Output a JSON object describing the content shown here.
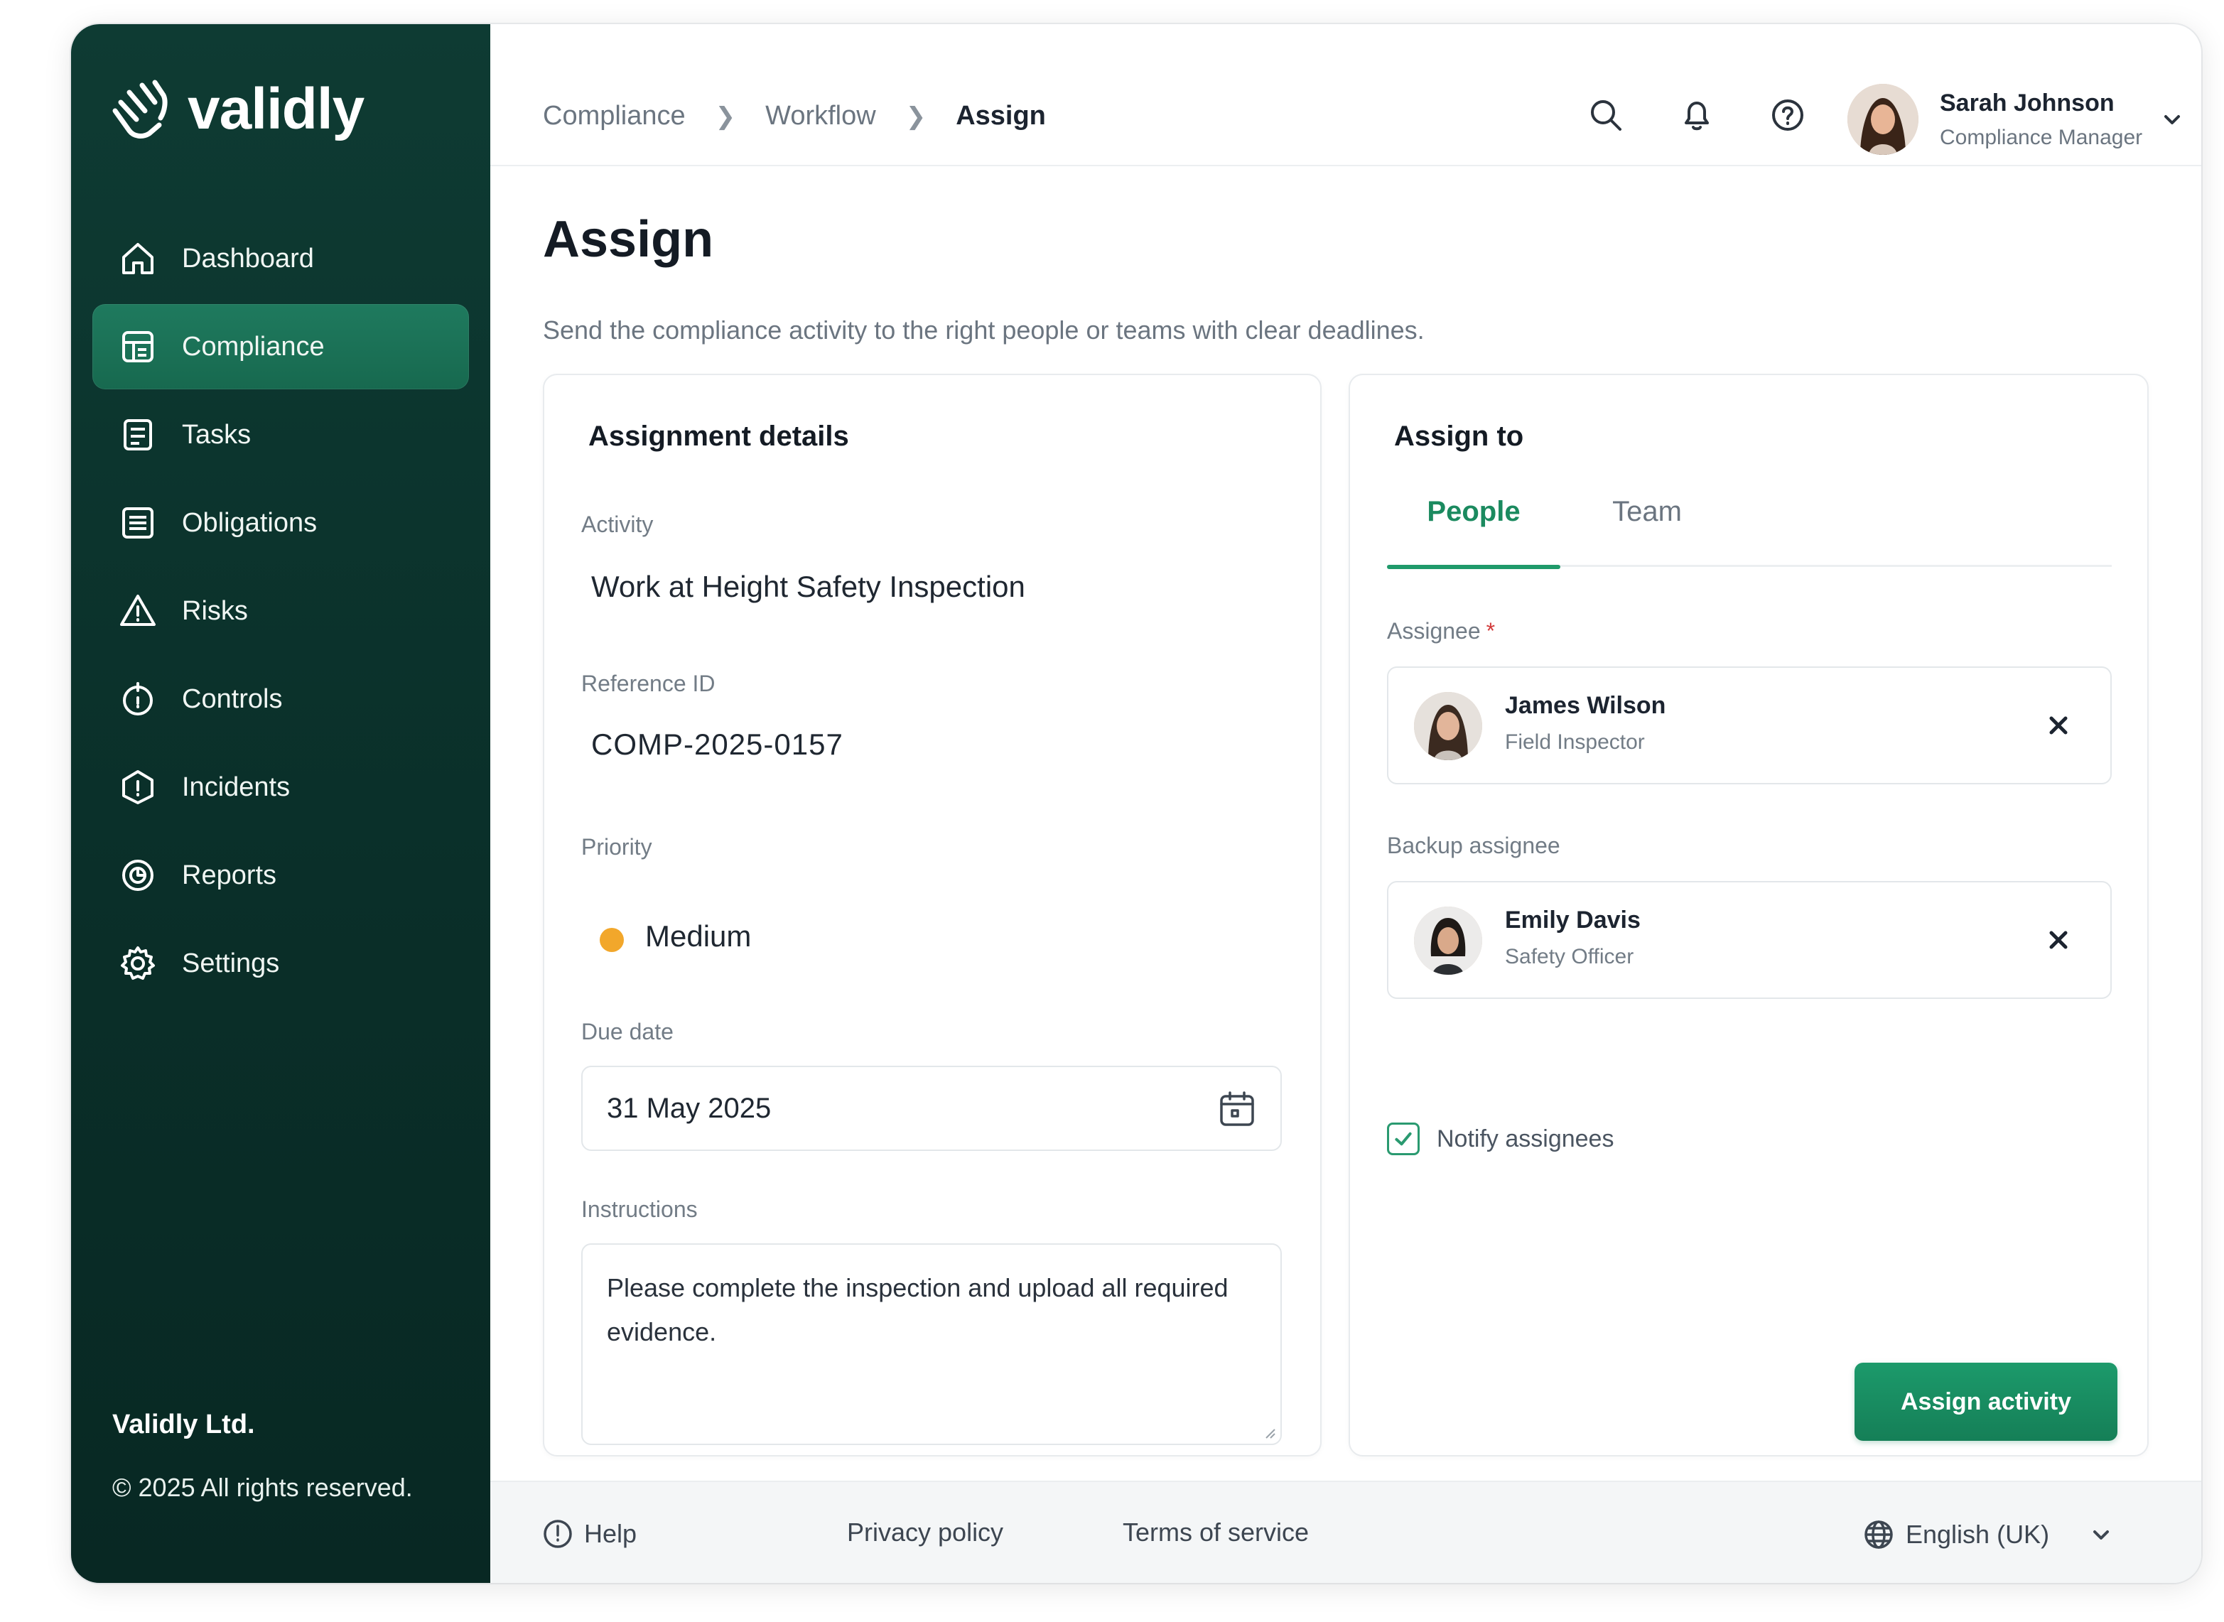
{
  "brand": {
    "name": "validly"
  },
  "sidebar": {
    "items": [
      {
        "label": "Dashboard",
        "icon": "home-icon"
      },
      {
        "label": "Compliance",
        "icon": "compliance-icon",
        "active": true
      },
      {
        "label": "Tasks",
        "icon": "tasks-icon"
      },
      {
        "label": "Obligations",
        "icon": "obligations-icon"
      },
      {
        "label": "Risks",
        "icon": "warning-triangle-icon"
      },
      {
        "label": "Controls",
        "icon": "shield-icon"
      },
      {
        "label": "Incidents",
        "icon": "incident-icon"
      },
      {
        "label": "Reports",
        "icon": "reports-icon"
      },
      {
        "label": "Settings",
        "icon": "gear-icon"
      }
    ],
    "footer": {
      "company": "Validly Ltd.",
      "rights": "© 2025 All rights reserved."
    }
  },
  "breadcrumb": {
    "items": [
      "Compliance",
      "Workflow",
      "Assign"
    ]
  },
  "user": {
    "name": "Sarah Johnson",
    "role": "Compliance Manager"
  },
  "page": {
    "title": "Assign",
    "subtitle": "Send the compliance activity to the right people or teams with clear deadlines."
  },
  "details": {
    "title": "Assignment details",
    "activity_label": "Activity",
    "activity_value": "Work at Height Safety Inspection",
    "reference_label": "Reference ID",
    "reference_value": "COMP-2025-0157",
    "priority_label": "Priority",
    "priority_value": "Medium",
    "priority_color": "#f2a72b",
    "due_label": "Due date",
    "due_value": "31 May 2025",
    "instructions_label": "Instructions",
    "instructions_value": "Please complete the inspection and upload all required evidence."
  },
  "assign": {
    "title": "Assign to",
    "tabs": [
      {
        "label": "People",
        "active": true
      },
      {
        "label": "Team",
        "active": false
      }
    ],
    "assignee_label": "Assignee",
    "required_mark": "*",
    "assignee": {
      "name": "James Wilson",
      "role": "Field Inspector"
    },
    "backup_label": "Backup assignee",
    "backup": {
      "name": "Emily Davis",
      "role": "Safety Officer"
    },
    "notify_label": "Notify assignees",
    "notify_checked": true,
    "submit_label": "Assign activity"
  },
  "footer": {
    "help": "Help",
    "privacy": "Privacy policy",
    "terms": "Terms of service",
    "language": "English (UK)"
  },
  "colors": {
    "sidebar_bg": "#0a2f29",
    "accent": "#1b8a5f",
    "priority_medium": "#f2a72b"
  }
}
